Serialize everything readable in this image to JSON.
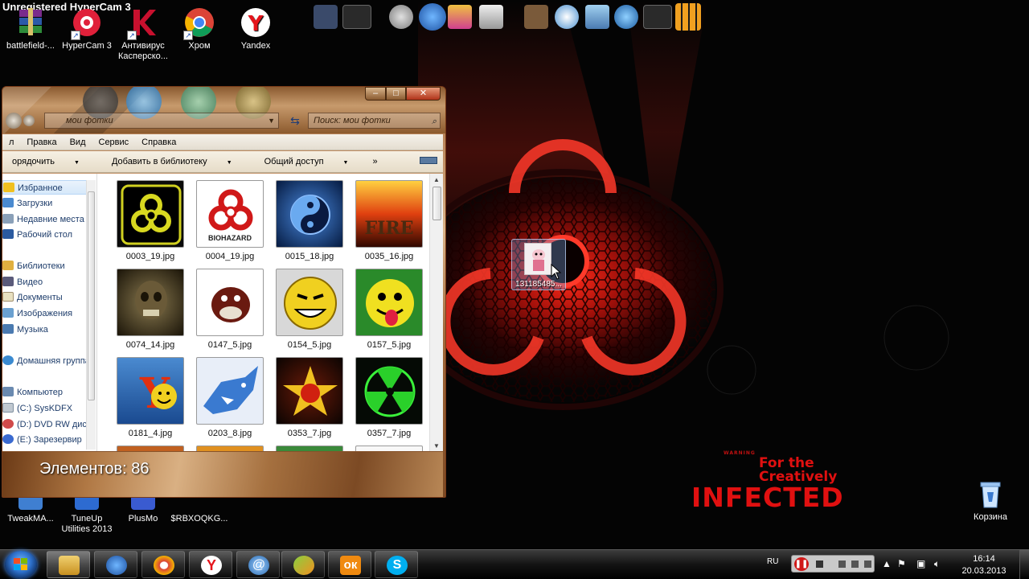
{
  "hypercam_watermark": "Unregistered HyperCam 3",
  "desktop_icons_top": [
    {
      "label": "battlefield-...",
      "color": "#7a2b8c"
    },
    {
      "label": "HyperCam 3",
      "color": "#e0203a"
    },
    {
      "label": "Антивирус Касперско...",
      "color": "#c8102e"
    },
    {
      "label": "Хром",
      "color": "#f4b400"
    },
    {
      "label": "Yandex",
      "color": "#e5141b"
    }
  ],
  "desktop_icons_bottom": [
    {
      "label": "TweakMA...",
      "color": "#3f7fd1"
    },
    {
      "label": "TuneUp Utilities 2013",
      "color": "#2d6bd1"
    },
    {
      "label": "PlusMo",
      "color": "#3a5bd0"
    },
    {
      "label": "$RBXOQKG...",
      "color": "#777777"
    }
  ],
  "recycle_bin": {
    "label": "Корзина"
  },
  "wallpaper": {
    "warning": "WARNING",
    "line1": "For the",
    "line2": "Creatively",
    "line3": "INFECTED"
  },
  "explorer": {
    "address": "мои фотки",
    "search_placeholder": "Поиск: мои фотки",
    "menu": [
      "л",
      "Правка",
      "Вид",
      "Сервис",
      "Справка"
    ],
    "toolbar": {
      "organize": "орядочить",
      "add_to_library": "Добавить в библиотеку",
      "share": "Общий доступ",
      "more": "»"
    },
    "nav": {
      "favorites": "Избранное",
      "downloads": "Загрузки",
      "recent": "Недавние места",
      "desktop": "Рабочий стол",
      "libraries": "Библиотеки",
      "video": "Видео",
      "documents": "Документы",
      "images": "Изображения",
      "music": "Музыка",
      "homegroup": "Домашняя группа",
      "computer": "Компьютер",
      "drive_c": "(C:) SysKDFX",
      "drive_d": "(D:) DVD RW дис",
      "drive_e": "(E:) Зарезервир"
    },
    "files": [
      "0003_19.jpg",
      "0004_19.jpg",
      "0015_18.jpg",
      "0035_16.jpg",
      "0074_14.jpg",
      "0147_5.jpg",
      "0154_5.jpg",
      "0157_5.jpg",
      "0181_4.jpg",
      "0203_8.jpg",
      "0353_7.jpg",
      "0357_7.jpg"
    ],
    "thumb_biohazard_text": "BIOHAZARD",
    "thumb_fire_text": "FIRE",
    "status": "Элементов: 86"
  },
  "dragged_file": {
    "name": "131185485..."
  },
  "taskbar": {
    "lang": "RU",
    "time": "16:14",
    "date": "20.03.2013"
  },
  "colors": {
    "accent_red": "#e01010",
    "window_frame": "#b07844",
    "nav_text": "#1e3d6b"
  }
}
